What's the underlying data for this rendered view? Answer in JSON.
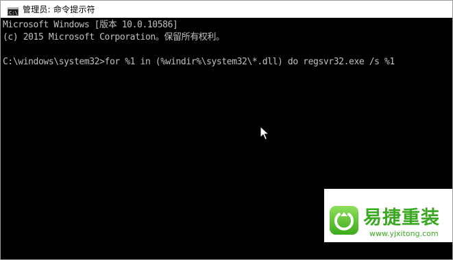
{
  "window": {
    "title": "管理员: 命令提示符",
    "icon": "cmd-icon"
  },
  "console": {
    "lines": [
      "Microsoft Windows [版本 10.0.10586]",
      "(c) 2015 Microsoft Corporation。保留所有权利。",
      "",
      "C:\\windows\\system32>for %1 in (%windir%\\system32\\*.dll) do regsvr32.exe /s %1"
    ],
    "text_color": "#c0c0c0",
    "background": "#000000"
  },
  "pointer": {
    "icon": "mouse-pointer-icon"
  },
  "watermark": {
    "brand": "易捷重装",
    "url": "www.yjxitong.com",
    "icon": "power-logo-icon",
    "color": "#3aa820"
  }
}
